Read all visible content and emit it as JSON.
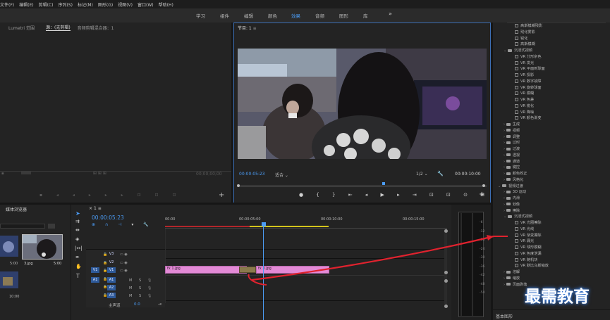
{
  "menu": [
    "文件(F)",
    "编辑(E)",
    "剪辑(C)",
    "序列(S)",
    "标记(M)",
    "图形(G)",
    "视图(V)",
    "窗口(W)",
    "帮助(H)"
  ],
  "workspaces": [
    "学习",
    "组件",
    "编辑",
    "颜色",
    "效果",
    "音频",
    "图形",
    "库"
  ],
  "workspace_active": "效果",
  "overflow": "»",
  "source_panel": {
    "tabs": [
      "Lumetri 范围",
      "源：(无剪辑)",
      "音频剪辑混合器：1"
    ],
    "timecode_left": "",
    "timecode_right": "00;00;00;00"
  },
  "program": {
    "title": "节目: 1",
    "menu_glyph": "≡",
    "timecode": "00:00:05:23",
    "fit": "适合",
    "resolution": "1/2",
    "duration": "00:00:10:00"
  },
  "project": {
    "title": "媒体浏览器",
    "items": [
      {
        "name": "",
        "duration": "5:00"
      },
      {
        "name": "3.jpg",
        "duration": "5:00"
      },
      {
        "name": "",
        "duration": "10:00"
      }
    ]
  },
  "timeline": {
    "tab_close": "×",
    "tab_name": "1",
    "menu_glyph": "≡",
    "timecode": "00:00:05:23",
    "ruler": [
      "00:00",
      "00:00:05:00",
      "00:00:10:00",
      "00:00:15:00"
    ],
    "tracks": [
      {
        "name": "V3",
        "type": "video"
      },
      {
        "name": "V2",
        "type": "video"
      },
      {
        "name": "V1",
        "type": "video",
        "src": "V1"
      },
      {
        "name": "A1",
        "type": "audio",
        "src": "A1"
      },
      {
        "name": "A2",
        "type": "audio"
      },
      {
        "name": "A3",
        "type": "audio"
      }
    ],
    "mute": "M",
    "solo": "S",
    "master": "主声道",
    "master_val": "0.0",
    "clip1": "1.jpg",
    "clip2": "3.jpg",
    "clip_fx": "fx"
  },
  "meters": {
    "scale": [
      "-6",
      "-12",
      "-18",
      "-24",
      "-30",
      "-36",
      "-42",
      "-48",
      "-54"
    ]
  },
  "effects": {
    "items": [
      {
        "label": "高斯模糊残影",
        "kind": "fx",
        "indent": 2
      },
      {
        "label": "残化雾影",
        "kind": "fx",
        "indent": 2
      },
      {
        "label": "锐化",
        "kind": "fx",
        "indent": 2
      },
      {
        "label": "高斯模糊",
        "kind": "fx",
        "indent": 2
      },
      {
        "label": "沉浸式视频",
        "kind": "folder",
        "indent": 1,
        "open": true
      },
      {
        "label": "VR 分形杂色",
        "kind": "fx",
        "indent": 2
      },
      {
        "label": "VR 发光",
        "kind": "fx",
        "indent": 2
      },
      {
        "label": "VR 平面到球面",
        "kind": "fx",
        "indent": 2
      },
      {
        "label": "VR 投影",
        "kind": "fx",
        "indent": 2
      },
      {
        "label": "VR 数字故障",
        "kind": "fx",
        "indent": 2
      },
      {
        "label": "VR 旋转球面",
        "kind": "fx",
        "indent": 2
      },
      {
        "label": "VR 模糊",
        "kind": "fx",
        "indent": 2
      },
      {
        "label": "VR 色差",
        "kind": "fx",
        "indent": 2
      },
      {
        "label": "VR 锐化",
        "kind": "fx",
        "indent": 2
      },
      {
        "label": "VR 降噪",
        "kind": "fx",
        "indent": 2
      },
      {
        "label": "VR 颜色渐变",
        "kind": "fx",
        "indent": 2
      },
      {
        "label": "生成",
        "kind": "folder",
        "indent": 1
      },
      {
        "label": "视频",
        "kind": "folder",
        "indent": 1
      },
      {
        "label": "调整",
        "kind": "folder",
        "indent": 1
      },
      {
        "label": "过时",
        "kind": "folder",
        "indent": 1
      },
      {
        "label": "过渡",
        "kind": "folder",
        "indent": 1
      },
      {
        "label": "透视",
        "kind": "folder",
        "indent": 1
      },
      {
        "label": "通道",
        "kind": "folder",
        "indent": 1
      },
      {
        "label": "键控",
        "kind": "folder",
        "indent": 1
      },
      {
        "label": "颜色校正",
        "kind": "folder",
        "indent": 1
      },
      {
        "label": "风格化",
        "kind": "folder",
        "indent": 1
      },
      {
        "label": "视频过渡",
        "kind": "folder",
        "indent": 0,
        "open": true
      },
      {
        "label": "3D 运动",
        "kind": "folder",
        "indent": 1
      },
      {
        "label": "内滑",
        "kind": "folder",
        "indent": 1
      },
      {
        "label": "划像",
        "kind": "folder",
        "indent": 1
      },
      {
        "label": "擦除",
        "kind": "folder",
        "indent": 1
      },
      {
        "label": "沉浸式视频",
        "kind": "folder",
        "indent": 1,
        "open": true
      },
      {
        "label": "VR 光圈擦除",
        "kind": "fx",
        "indent": 2,
        "selected": true
      },
      {
        "label": "VR 光线",
        "kind": "fx",
        "indent": 2
      },
      {
        "label": "VR 渐变擦除",
        "kind": "fx",
        "indent": 2
      },
      {
        "label": "VR 漏光",
        "kind": "fx",
        "indent": 2
      },
      {
        "label": "VR 球形模糊",
        "kind": "fx",
        "indent": 2
      },
      {
        "label": "VR 色度泄漏",
        "kind": "fx",
        "indent": 2
      },
      {
        "label": "VR 随机块",
        "kind": "fx",
        "indent": 2
      },
      {
        "label": "VR 默比乌斯缩放",
        "kind": "fx",
        "indent": 2
      },
      {
        "label": "溶解",
        "kind": "folder",
        "indent": 1
      },
      {
        "label": "缩放",
        "kind": "folder",
        "indent": 1
      },
      {
        "label": "页面剥落",
        "kind": "folder",
        "indent": 1
      }
    ],
    "bottom": "基本图形"
  },
  "watermark": "最需教育",
  "colors": {
    "accent": "#4b9cf5",
    "clip": "#e38ad6",
    "arrow": "#e0222e",
    "playhead": "#4b9cf5"
  }
}
